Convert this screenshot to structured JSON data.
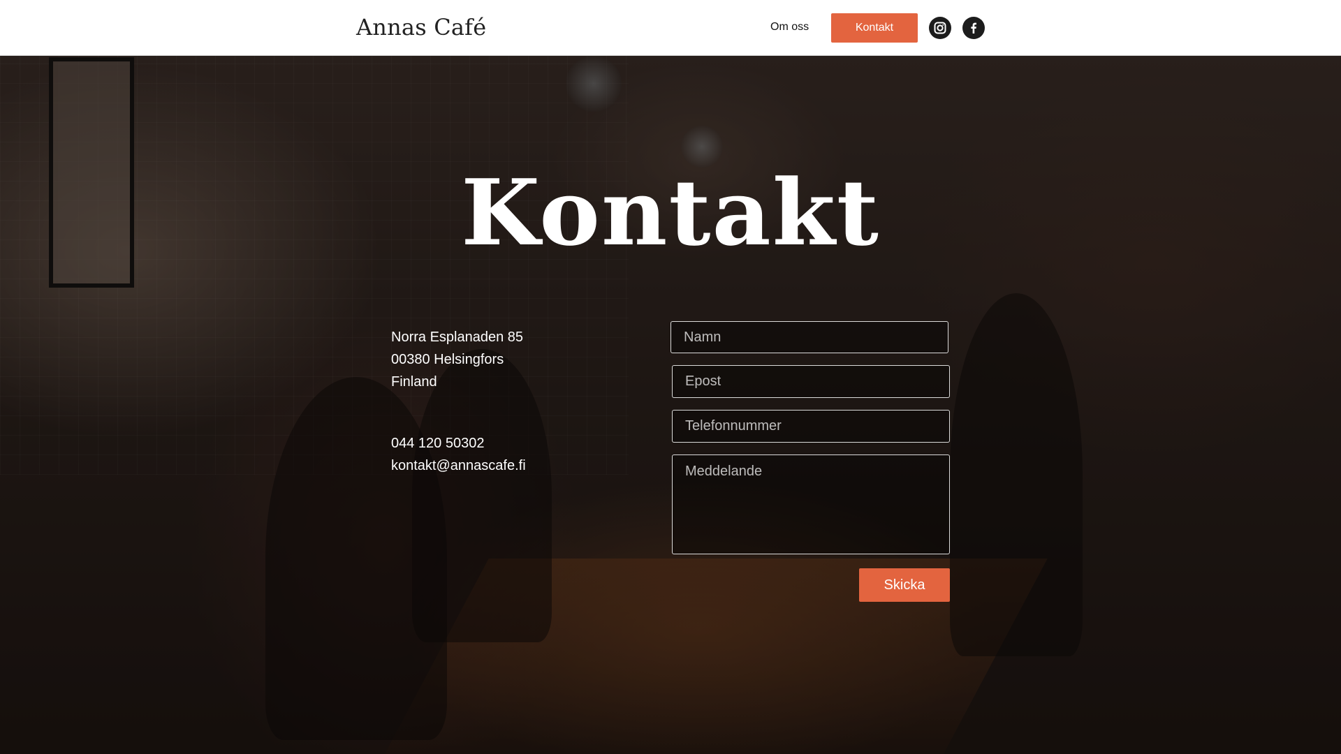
{
  "header": {
    "brand": "Annas Café",
    "nav": {
      "about_label": "Om oss",
      "contact_label": "Kontakt"
    },
    "social": {
      "instagram_icon": "instagram-icon",
      "facebook_icon": "facebook-icon"
    }
  },
  "main": {
    "title": "Kontakt",
    "address": {
      "line1": "Norra Esplanaden 85",
      "line2": "00380 Helsingfors",
      "line3": "Finland"
    },
    "contact": {
      "phone": "044 120 50302",
      "email": "kontakt@annascafe.fi"
    },
    "form": {
      "name_placeholder": "Namn",
      "email_placeholder": "Epost",
      "phone_placeholder": "Telefonnummer",
      "message_placeholder": "Meddelande",
      "submit_label": "Skicka"
    }
  },
  "colors": {
    "accent": "#e3643f",
    "header_bg": "#ffffff",
    "text_light": "#ffffff"
  }
}
